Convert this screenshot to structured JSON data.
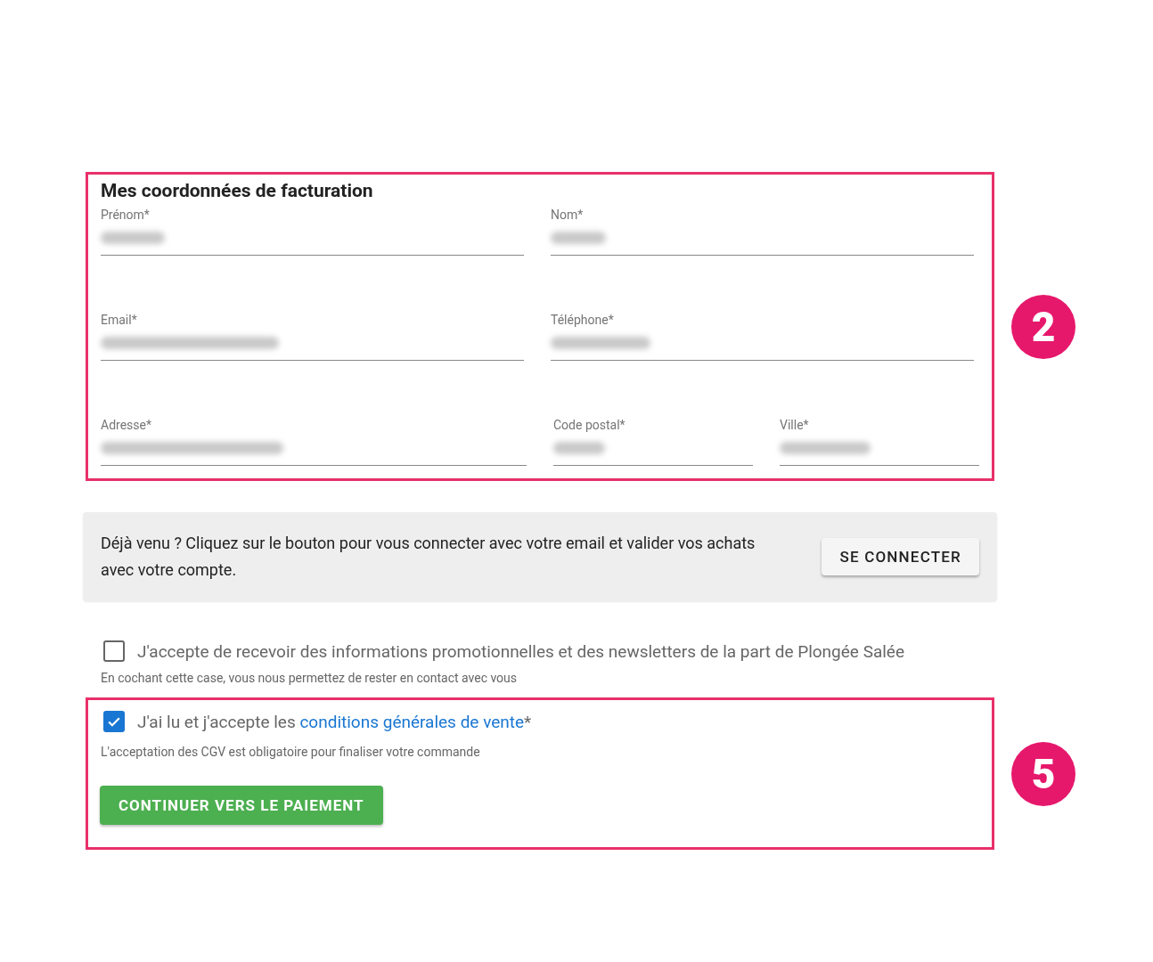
{
  "billing": {
    "callout": "2",
    "title": "Mes coordonnées de facturation",
    "rows": [
      [
        {
          "label": "Prénom*",
          "value_blurred": true
        },
        {
          "label": "Nom*",
          "value_blurred": true
        }
      ],
      [
        {
          "label": "Email*",
          "value_blurred": true
        },
        {
          "label": "Téléphone*",
          "value_blurred": true
        }
      ],
      [
        {
          "label": "Adresse*",
          "value_blurred": true
        },
        {
          "label": "Code postal*",
          "value_blurred": true
        },
        {
          "label": "Ville*",
          "value_blurred": true
        }
      ]
    ]
  },
  "login_panel": {
    "text": "Déjà venu ? Cliquez sur le bouton pour vous connecter avec votre email et valider vos achats avec votre compte.",
    "button": "SE CONNECTER"
  },
  "newsletter": {
    "checked": false,
    "label": "J'accepte de recevoir des informations promotionnelles et des newsletters de la part de Plongée Salée",
    "hint": "En cochant cette case, vous nous permettez de rester en contact avec vous"
  },
  "terms": {
    "callout": "5",
    "checked": true,
    "label": "J'ai lu et j'accepte les ",
    "link": "conditions générales de vente",
    "suffix": "*",
    "hint": "L'acceptation des CGV est obligatoire pour finaliser votre commande",
    "button": "CONTINUER VERS LE PAIEMENT"
  }
}
